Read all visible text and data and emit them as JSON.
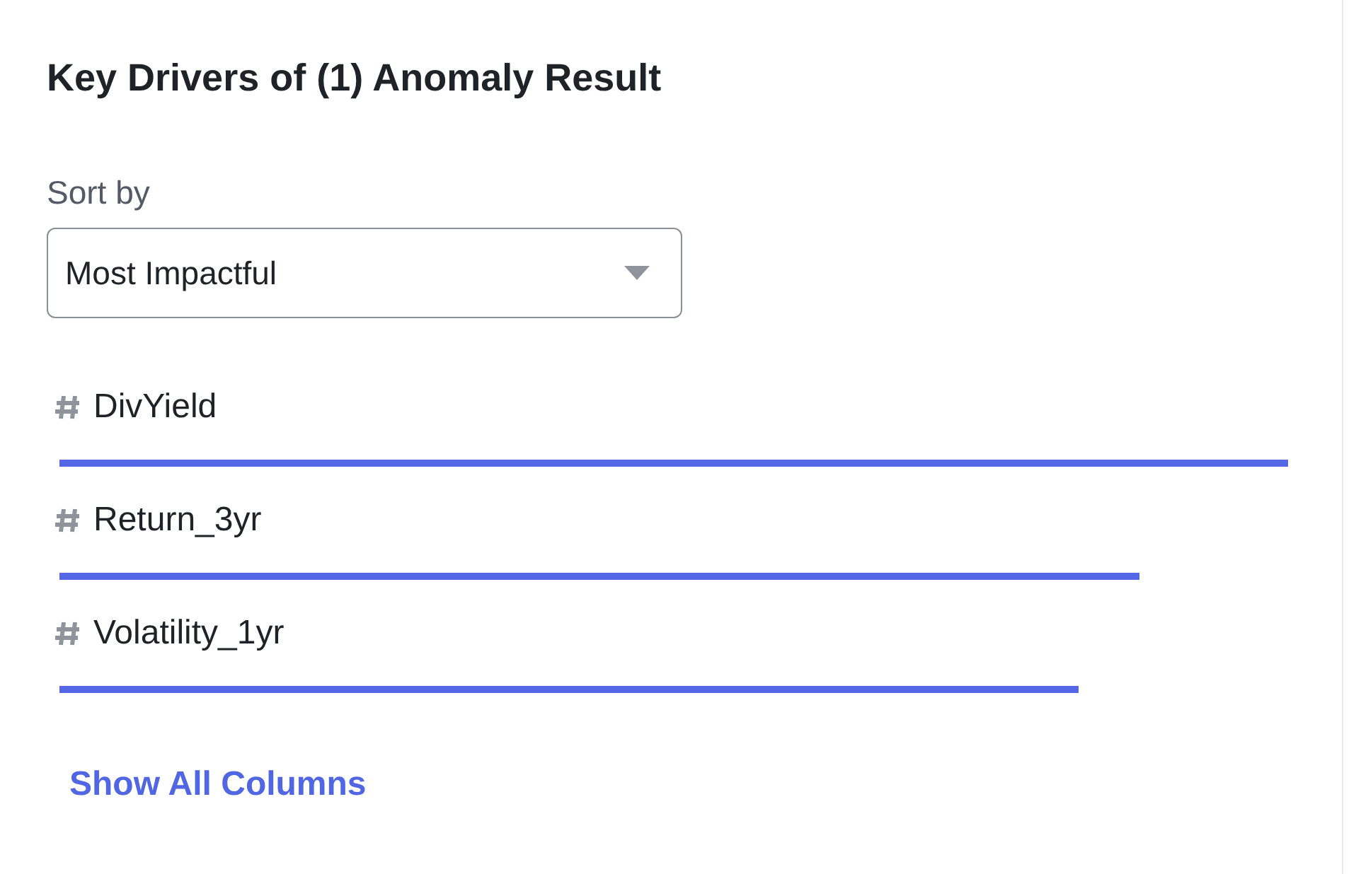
{
  "title": "Key Drivers of (1) Anomaly Result",
  "sort": {
    "label": "Sort by",
    "value": "Most Impactful"
  },
  "drivers": [
    {
      "name": "DivYield"
    },
    {
      "name": "Return_3yr"
    },
    {
      "name": "Volatility_1yr"
    }
  ],
  "link": "Show All Columns"
}
